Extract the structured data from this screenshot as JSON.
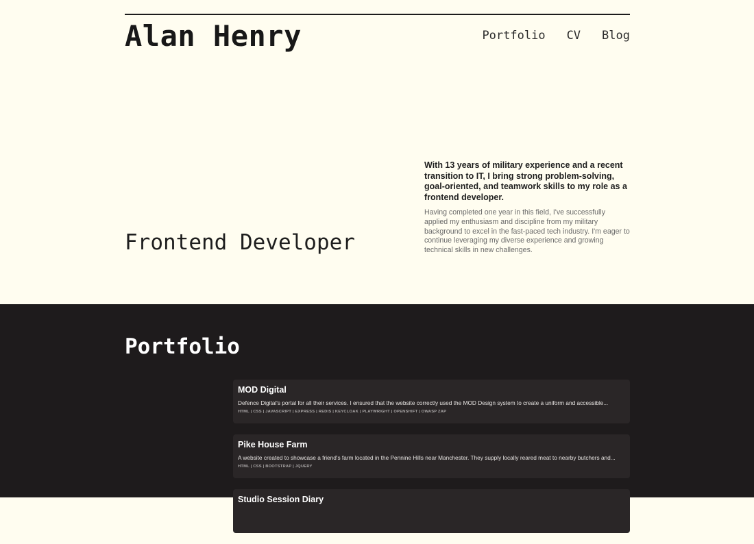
{
  "header": {
    "name": "Alan Henry",
    "nav": [
      "Portfolio",
      "CV",
      "Blog"
    ]
  },
  "hero": {
    "role": "Frontend Developer",
    "lead": "With 13 years of military experience and a recent transition to IT, I bring strong problem-solving, goal-oriented, and teamwork skills to my role as a frontend developer.",
    "body": "Having completed one year in this field, I've successfully applied my enthusiasm and discipline from my military background to excel in the fast-paced tech industry. I'm eager to continue leveraging my diverse experience and growing technical skills in new challenges."
  },
  "portfolio": {
    "title": "Portfolio",
    "items": [
      {
        "title": "MOD Digital",
        "description": "Defence Digital's portal for all their services. I ensured that the website correctly used the MOD Design system to create a uniform and accessible...",
        "tags": "HTML | CSS | JAVASCRIPT | EXPRESS | REDIS | KEYCLOAK | PLAYWRIGHT | OPENSHIFT | OWASP ZAP"
      },
      {
        "title": "Pike House Farm",
        "description": "A website created to showcase a friend's farm located in the Pennine Hills near Manchester. They supply locally reared meat to nearby butchers and...",
        "tags": "HTML | CSS | BOOTSTRAP | JQUERY"
      },
      {
        "title": "Studio Session Diary",
        "description": "",
        "tags": ""
      }
    ]
  }
}
